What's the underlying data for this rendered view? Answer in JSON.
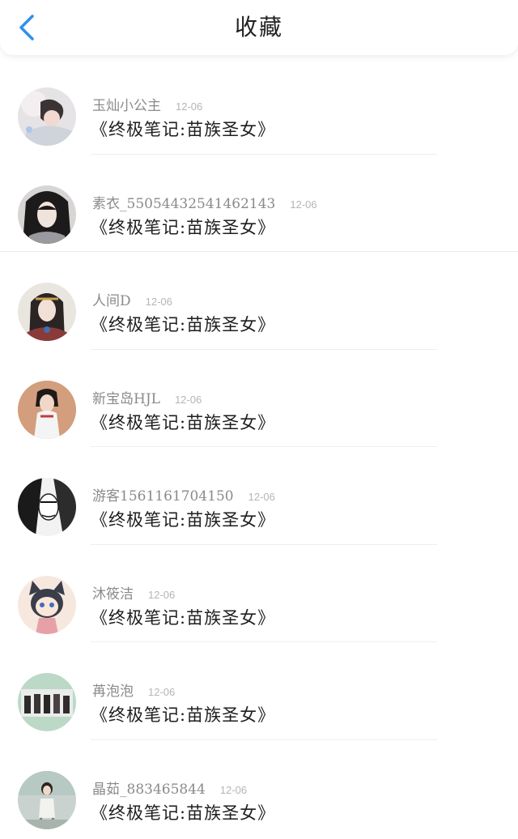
{
  "header": {
    "title": "收藏",
    "back_icon": "chevron-left-icon",
    "accent_color": "#2f8ff0"
  },
  "favorites": [
    {
      "username": "玉灿小公主",
      "date": "12-06",
      "book": "《终极笔记:苗族圣女》"
    },
    {
      "username": "素衣_55054432541462143",
      "date": "12-06",
      "book": "《终极笔记:苗族圣女》"
    },
    {
      "username": "人间D",
      "date": "12-06",
      "book": "《终极笔记:苗族圣女》"
    },
    {
      "username": "新宝岛HJL",
      "date": "12-06",
      "book": "《终极笔记:苗族圣女》"
    },
    {
      "username": "游客1561161704150",
      "date": "12-06",
      "book": "《终极笔记:苗族圣女》"
    },
    {
      "username": "沐筱洁",
      "date": "12-06",
      "book": "《终极笔记:苗族圣女》"
    },
    {
      "username": "苒泡泡",
      "date": "12-06",
      "book": "《终极笔记:苗族圣女》"
    },
    {
      "username": "晶茹_883465844",
      "date": "12-06",
      "book": "《终极笔记:苗族圣女》"
    }
  ]
}
